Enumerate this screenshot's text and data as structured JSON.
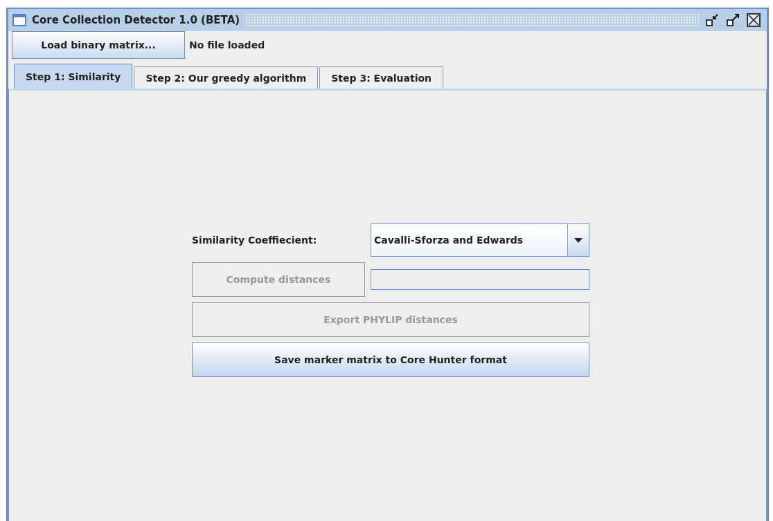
{
  "window": {
    "title": "Core Collection Detector 1.0 (BETA)"
  },
  "toolbar": {
    "load_button": "Load binary matrix...",
    "status": "No file loaded"
  },
  "tabs": [
    {
      "label": "Step 1: Similarity",
      "selected": true
    },
    {
      "label": "Step 2: Our greedy algorithm",
      "selected": false
    },
    {
      "label": "Step 3: Evaluation",
      "selected": false
    }
  ],
  "form": {
    "coefficient_label": "Similarity Coeffiecient:",
    "coefficient_value": "Cavalli-Sforza and Edwards",
    "buttons": [
      {
        "label": "Compute distances",
        "disabled": true
      },
      {
        "label": "Export PHYLIP distances",
        "disabled": true
      },
      {
        "label": "Save marker matrix to Core Hunter format",
        "disabled": false
      }
    ]
  }
}
